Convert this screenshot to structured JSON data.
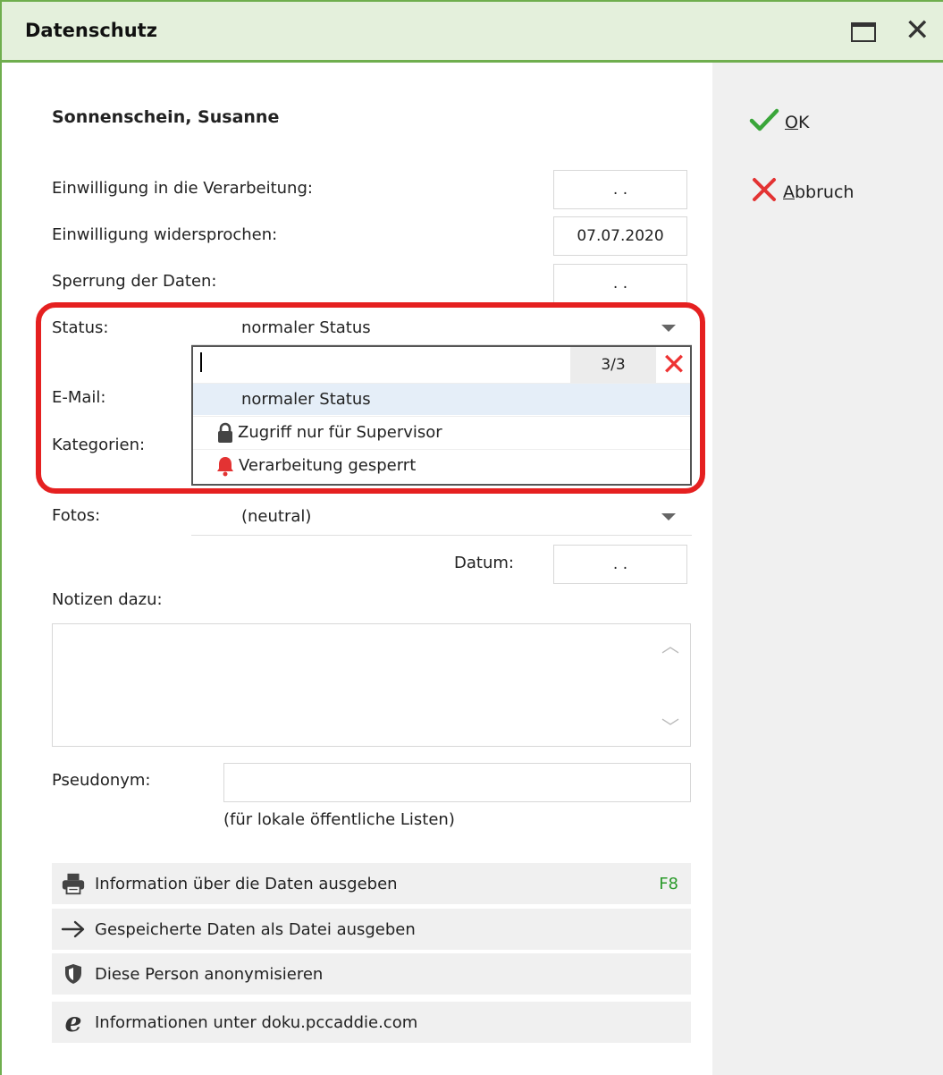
{
  "window": {
    "title": "Datenschutz"
  },
  "sidebar": {
    "ok_mnemonic": "O",
    "ok_rest": "K",
    "cancel_mnemonic": "A",
    "cancel_rest": "bbruch"
  },
  "person": {
    "name": "Sonnenschein, Susanne"
  },
  "fields": {
    "consent_label": "Einwilligung in die Verarbeitung:",
    "consent_value": ". .",
    "objection_label": "Einwilligung widersprochen:",
    "objection_value": "07.07.2020",
    "blocking_label": "Sperrung der Daten:",
    "blocking_value": ". .",
    "status_label": "Status:",
    "status_value": "normaler Status",
    "email_label": "E-Mail:",
    "categories_label": "Kategorien:",
    "photos_label": "Fotos:",
    "photos_value": "(neutral)",
    "date_label": "Datum:",
    "date_value": ". .",
    "notes_label": "Notizen dazu:",
    "pseudonym_label": "Pseudonym:",
    "pseudonym_value": "",
    "pseudonym_hint": "(für lokale öffentliche Listen)"
  },
  "dropdown": {
    "search_value": "",
    "count": "3/3",
    "options": [
      {
        "label": "normaler Status",
        "icon": "none",
        "selected": true
      },
      {
        "label": "Zugriff nur für Supervisor",
        "icon": "lock-icon"
      },
      {
        "label": "Verarbeitung gesperrt",
        "icon": "bell-icon"
      }
    ]
  },
  "actions": {
    "print_label": "Information über die Daten ausgeben",
    "print_shortcut": "F8",
    "export_label": "Gespeicherte Daten als Datei ausgeben",
    "anonymize_label": "Diese Person anonymisieren",
    "info_label": "Informationen unter doku.pccaddie.com"
  },
  "colors": {
    "title_bar": "#e4f0dc",
    "title_border": "#6fae4e",
    "highlight": "#e52020",
    "ok_green": "#3aa63a",
    "cancel_red": "#e33333",
    "shortcut_green": "#2a9a2a"
  }
}
